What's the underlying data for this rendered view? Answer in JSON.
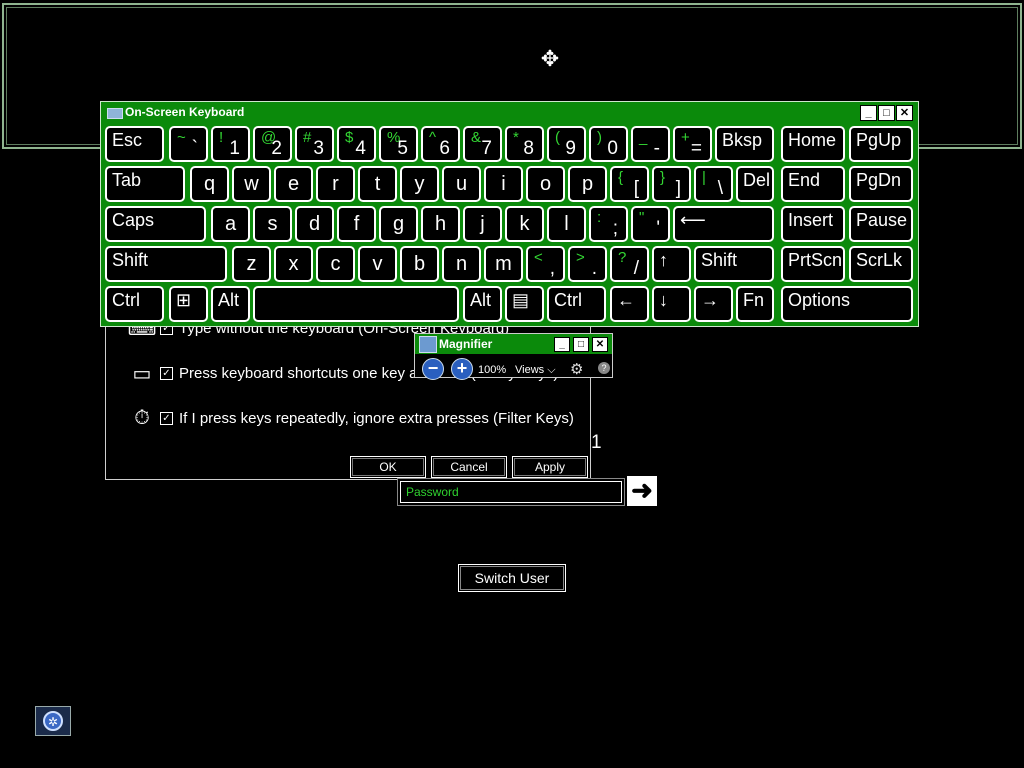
{
  "screen": {
    "move_cursor": "✥",
    "step_number": "1"
  },
  "ease_dialog": {
    "options": [
      {
        "icon": "keyboard-icon",
        "icon_glyph": "⌨",
        "checked": "✓",
        "label": "Type without the keyboard (On-Screen Keyboard)"
      },
      {
        "icon": "sticky-keys-icon",
        "icon_glyph": "▭",
        "checked": "✓",
        "label": "Press keyboard shortcuts one key at a time (Sticky Keys)"
      },
      {
        "icon": "stopwatch-icon",
        "icon_glyph": "⏱",
        "checked": "✓",
        "label": "If I press keys repeatedly, ignore extra presses (Filter Keys)"
      }
    ],
    "ok_label": "OK",
    "cancel_label": "Cancel",
    "apply_label": "Apply"
  },
  "login": {
    "password_placeholder": "Password",
    "submit_glyph": "➜",
    "switch_user_label": "Switch User",
    "ease_of_access_glyph": "✲"
  },
  "osk": {
    "title": "On-Screen Keyboard",
    "minimize": "_",
    "maximize": "□",
    "close": "✕",
    "rows": [
      [
        {
          "t": "label",
          "l": "Esc"
        },
        {
          "t": "dual",
          "s": "~",
          "b": "`"
        },
        {
          "t": "dual",
          "s": "!",
          "b": "1"
        },
        {
          "t": "dual",
          "s": "@",
          "b": "2"
        },
        {
          "t": "dual",
          "s": "#",
          "b": "3"
        },
        {
          "t": "dual",
          "s": "$",
          "b": "4"
        },
        {
          "t": "dual",
          "s": "%",
          "b": "5"
        },
        {
          "t": "dual",
          "s": "^",
          "b": "6"
        },
        {
          "t": "dual",
          "s": "&",
          "b": "7"
        },
        {
          "t": "dual",
          "s": "*",
          "b": "8"
        },
        {
          "t": "dual",
          "s": "(",
          "b": "9"
        },
        {
          "t": "dual",
          "s": ")",
          "b": "0"
        },
        {
          "t": "dual",
          "s": "_",
          "b": "-"
        },
        {
          "t": "dual",
          "s": "+",
          "b": "="
        },
        {
          "t": "label",
          "l": "Bksp"
        },
        {
          "t": "label",
          "l": "Home"
        },
        {
          "t": "label",
          "l": "PgUp"
        }
      ],
      [
        {
          "t": "label",
          "l": "Tab"
        },
        {
          "t": "char",
          "c": "q"
        },
        {
          "t": "char",
          "c": "w"
        },
        {
          "t": "char",
          "c": "e"
        },
        {
          "t": "char",
          "c": "r"
        },
        {
          "t": "char",
          "c": "t"
        },
        {
          "t": "char",
          "c": "y"
        },
        {
          "t": "char",
          "c": "u"
        },
        {
          "t": "char",
          "c": "i"
        },
        {
          "t": "char",
          "c": "o"
        },
        {
          "t": "char",
          "c": "p"
        },
        {
          "t": "dual",
          "s": "{",
          "b": "["
        },
        {
          "t": "dual",
          "s": "}",
          "b": "]"
        },
        {
          "t": "dual",
          "s": "|",
          "b": "\\"
        },
        {
          "t": "label",
          "l": "Del"
        },
        {
          "t": "label",
          "l": "End"
        },
        {
          "t": "label",
          "l": "PgDn"
        }
      ],
      [
        {
          "t": "label",
          "l": "Caps"
        },
        {
          "t": "char",
          "c": "a"
        },
        {
          "t": "char",
          "c": "s"
        },
        {
          "t": "char",
          "c": "d"
        },
        {
          "t": "char",
          "c": "f"
        },
        {
          "t": "char",
          "c": "g"
        },
        {
          "t": "char",
          "c": "h"
        },
        {
          "t": "char",
          "c": "j"
        },
        {
          "t": "char",
          "c": "k"
        },
        {
          "t": "char",
          "c": "l"
        },
        {
          "t": "dual",
          "s": ":",
          "b": ";"
        },
        {
          "t": "dual",
          "s": "\"",
          "b": "'"
        },
        {
          "t": "label",
          "l": "⟵"
        },
        {
          "t": "label",
          "l": "Insert"
        },
        {
          "t": "label",
          "l": "Pause"
        }
      ],
      [
        {
          "t": "label",
          "l": "Shift"
        },
        {
          "t": "char",
          "c": "z"
        },
        {
          "t": "char",
          "c": "x"
        },
        {
          "t": "char",
          "c": "c"
        },
        {
          "t": "char",
          "c": "v"
        },
        {
          "t": "char",
          "c": "b"
        },
        {
          "t": "char",
          "c": "n"
        },
        {
          "t": "char",
          "c": "m"
        },
        {
          "t": "dual",
          "s": "<",
          "b": ","
        },
        {
          "t": "dual",
          "s": ">",
          "b": "."
        },
        {
          "t": "dual",
          "s": "?",
          "b": "/"
        },
        {
          "t": "label",
          "l": "↑"
        },
        {
          "t": "label",
          "l": "Shift"
        },
        {
          "t": "label",
          "l": "PrtScn"
        },
        {
          "t": "label",
          "l": "ScrLk"
        }
      ],
      [
        {
          "t": "label",
          "l": "Ctrl"
        },
        {
          "t": "label",
          "l": "⊞"
        },
        {
          "t": "label",
          "l": "Alt"
        },
        {
          "t": "label",
          "l": ""
        },
        {
          "t": "label",
          "l": "Alt"
        },
        {
          "t": "label",
          "l": "▤"
        },
        {
          "t": "label",
          "l": "Ctrl"
        },
        {
          "t": "label",
          "l": "←"
        },
        {
          "t": "label",
          "l": "↓"
        },
        {
          "t": "label",
          "l": "→"
        },
        {
          "t": "label",
          "l": "Fn"
        },
        {
          "t": "label",
          "l": "Options"
        }
      ]
    ]
  },
  "magnifier": {
    "title": "Magnifier",
    "zoom_out": "−",
    "zoom_in": "+",
    "zoom_level": "100%",
    "views_label": "Views ⌵",
    "gear": "⚙",
    "help": "?",
    "minimize": "_",
    "maximize": "□",
    "close": "✕"
  }
}
